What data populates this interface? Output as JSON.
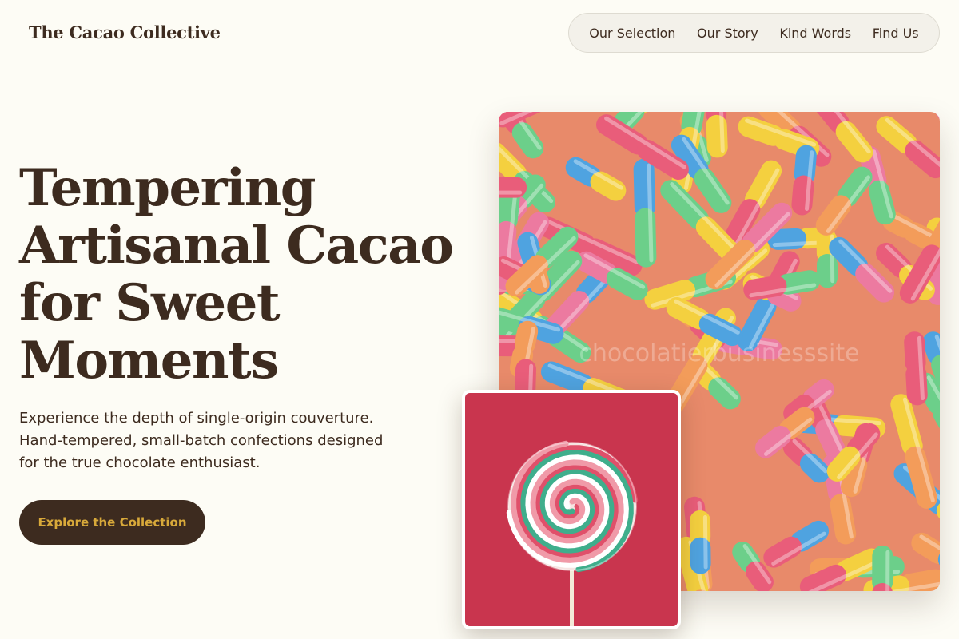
{
  "header": {
    "brand": "The Cacao Collective",
    "nav": [
      {
        "label": "Our Selection"
      },
      {
        "label": "Our Story"
      },
      {
        "label": "Kind Words"
      },
      {
        "label": "Find Us"
      }
    ]
  },
  "hero": {
    "headline_lines": [
      "Tempering",
      "Artisanal Cacao",
      "for Sweet",
      "Moments"
    ],
    "subtext_lines": [
      "Experience the depth of single-origin couverture.",
      "Hand-tempered, small-batch confections designed",
      "for the true chocolate enthusiast."
    ],
    "cta_label": "Explore the Collection"
  },
  "images": {
    "main": {
      "subject": "sour gummy worms",
      "watermark": "chocolatierbusinesssite"
    },
    "inset": {
      "subject": "swirl lollipop on red background"
    }
  },
  "colors": {
    "background": "#fdfcf5",
    "text": "#3d2b1f",
    "cta_bg": "#3d2b1f",
    "cta_text": "#d8a93a",
    "nav_bg": "#f3f1ea",
    "inset_bg": "#c9354e"
  }
}
